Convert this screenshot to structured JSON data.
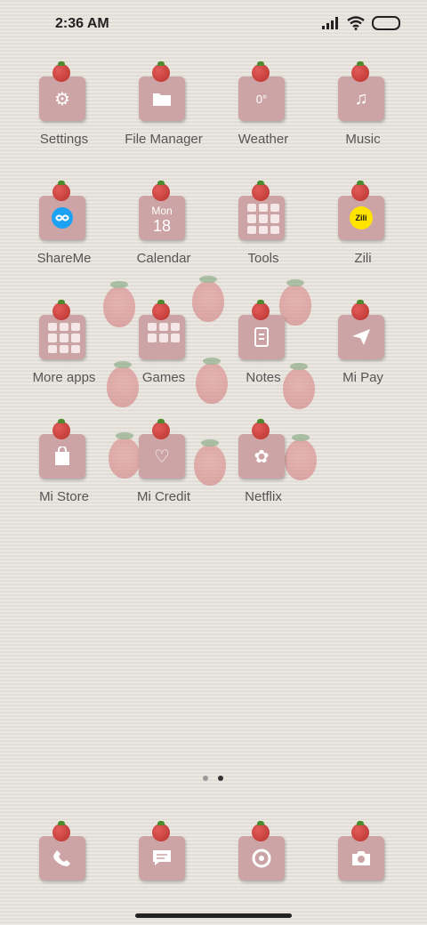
{
  "status_bar": {
    "time": "2:36 AM"
  },
  "apps": [
    {
      "label": "Settings",
      "icon": "gear-icon"
    },
    {
      "label": "File Manager",
      "icon": "folder-icon"
    },
    {
      "label": "Weather",
      "icon": "weather-icon",
      "extra": "0°"
    },
    {
      "label": "Music",
      "icon": "music-note-icon"
    },
    {
      "label": "ShareMe",
      "icon": "shareme-icon"
    },
    {
      "label": "Calendar",
      "icon": "calendar-icon",
      "day": "Mon",
      "date": "18"
    },
    {
      "label": "Tools",
      "icon": "folder-grid-icon"
    },
    {
      "label": "Zili",
      "icon": "zili-icon",
      "extra": "Zili"
    },
    {
      "label": "More apps",
      "icon": "folder-grid-icon"
    },
    {
      "label": "Games",
      "icon": "folder-grid-icon"
    },
    {
      "label": "Notes",
      "icon": "notes-icon"
    },
    {
      "label": "Mi Pay",
      "icon": "paper-plane-icon"
    },
    {
      "label": "Mi Store",
      "icon": "shopping-bag-icon"
    },
    {
      "label": "Mi Credit",
      "icon": "heart-icon"
    },
    {
      "label": "Netflix",
      "icon": "netflix-flower-icon"
    }
  ],
  "dock": [
    {
      "name": "phone",
      "icon": "phone-icon"
    },
    {
      "name": "messages",
      "icon": "message-icon"
    },
    {
      "name": "browser",
      "icon": "browser-icon"
    },
    {
      "name": "camera",
      "icon": "camera-icon"
    }
  ],
  "page_indicator": {
    "total": 2,
    "active": 2
  },
  "colors": {
    "tile": "#cda4a5",
    "strawberry": "#c53b38",
    "label": "#555555",
    "dot_active": "#333333",
    "dot_inactive": "#999999"
  }
}
